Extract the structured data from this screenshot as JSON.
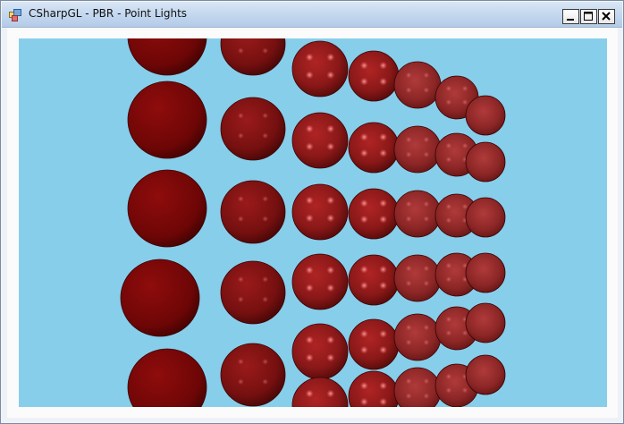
{
  "window": {
    "title": "CSharpGL - PBR - Point Lights",
    "icon": "app-window-icon",
    "buttons": {
      "minimize": "minimize-icon",
      "maximize": "maximize-icon",
      "close": "close-icon"
    }
  },
  "scene": {
    "background_color": "#87ceeb",
    "sphere_base_color": "#7a0c0c",
    "rows": 7,
    "columns": 7,
    "description_type": "sphere-grid"
  }
}
